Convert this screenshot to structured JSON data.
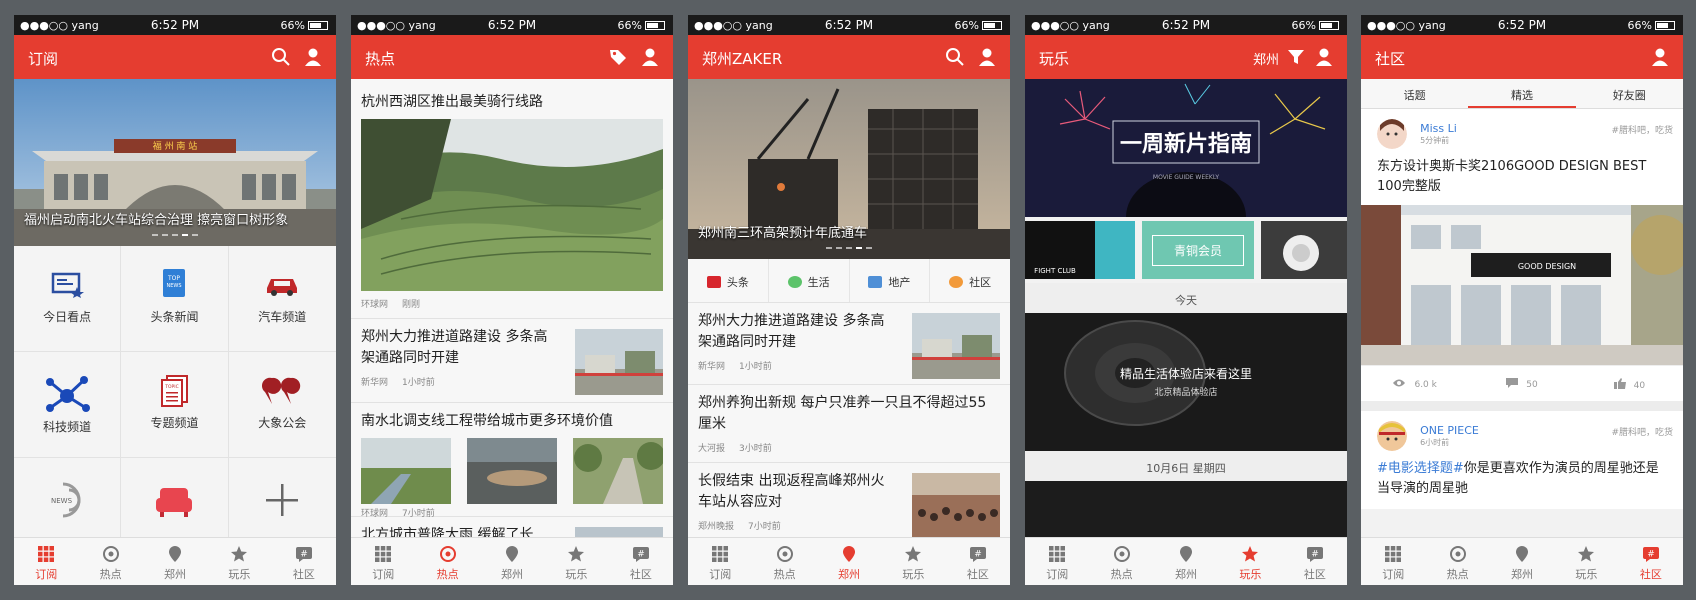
{
  "status": {
    "carrier": "●●●○○ yang",
    "time": "6:52 PM",
    "battery": "66%"
  },
  "tabs": [
    "订阅",
    "热点",
    "郑州",
    "玩乐",
    "社区"
  ],
  "phone1": {
    "title": "订阅",
    "hero_caption": "福州启动南北火车站综合治理 擦亮窗口树形象",
    "station_sign": "福 州 南 站",
    "grid": [
      "今日看点",
      "头条新闻",
      "汽车频道",
      "科技频道",
      "专题频道",
      "大象公会",
      "",
      "",
      ""
    ],
    "colors": {
      "accent": "#e53d30"
    }
  },
  "phone2": {
    "title": "热点",
    "headline": "杭州西湖区推出最美骑行线路",
    "headline_source": "环球网",
    "headline_time": "刚刚",
    "article1": {
      "title": "郑州大力推进道路建设 多条高架通路同时开建",
      "source": "新华网",
      "time": "1小时前"
    },
    "article2": {
      "title": "南水北调支线工程带给城市更多环境价值",
      "source": "环球网",
      "time": "7小时前"
    },
    "article3": {
      "title": "北方城市普降大雨 缓解了长"
    }
  },
  "phone3": {
    "title": "郑州ZAKER",
    "hero_caption": "郑州南三环高架预计年底通车",
    "cats": [
      "头条",
      "生活",
      "地产",
      "社区"
    ],
    "articles": [
      {
        "title": "郑州大力推进道路建设 多条高架通路同时开建",
        "source": "新华网",
        "time": "1小时前"
      },
      {
        "title": "郑州养狗出新规 每户只准养一只且不得超过55厘米",
        "source": "大河报",
        "time": "3小时前"
      },
      {
        "title": "长假结束 出现返程高峰郑州火车站从容应对",
        "source": "郑州晚报",
        "time": "7小时前"
      }
    ]
  },
  "phone4": {
    "title": "玩乐",
    "city": "郑州",
    "banner_title": "一周新片指南",
    "banner_sub": "MOVIE GUIDE WEEKLY",
    "tile1": "FIGHT CLUB",
    "tile2": "青铜会员",
    "day1": "今天",
    "promo_title": "精品生活体验店来看这里",
    "promo_sub": "北京精品体验店",
    "day2": "10月6日 星期四"
  },
  "phone5": {
    "title": "社区",
    "subtabs": [
      "话题",
      "精选",
      "好友圈"
    ],
    "post1": {
      "user": "Miss Li",
      "ago": "5分钟前",
      "tag": "#腊科吧，吃货",
      "text": "东方设计奥斯卡奖2106GOOD DESIGN BEST 100完整版",
      "sign": "GOOD DESIGN",
      "views": "6.0 k",
      "comments": "50",
      "likes": "40"
    },
    "post2": {
      "user": "ONE PIECE",
      "ago": "6小时前",
      "tag": "#腊科吧，吃货",
      "hashtag": "#电影选择题#",
      "text": "你是更喜欢作为演员的周星驰还是当导演的周星驰"
    }
  }
}
